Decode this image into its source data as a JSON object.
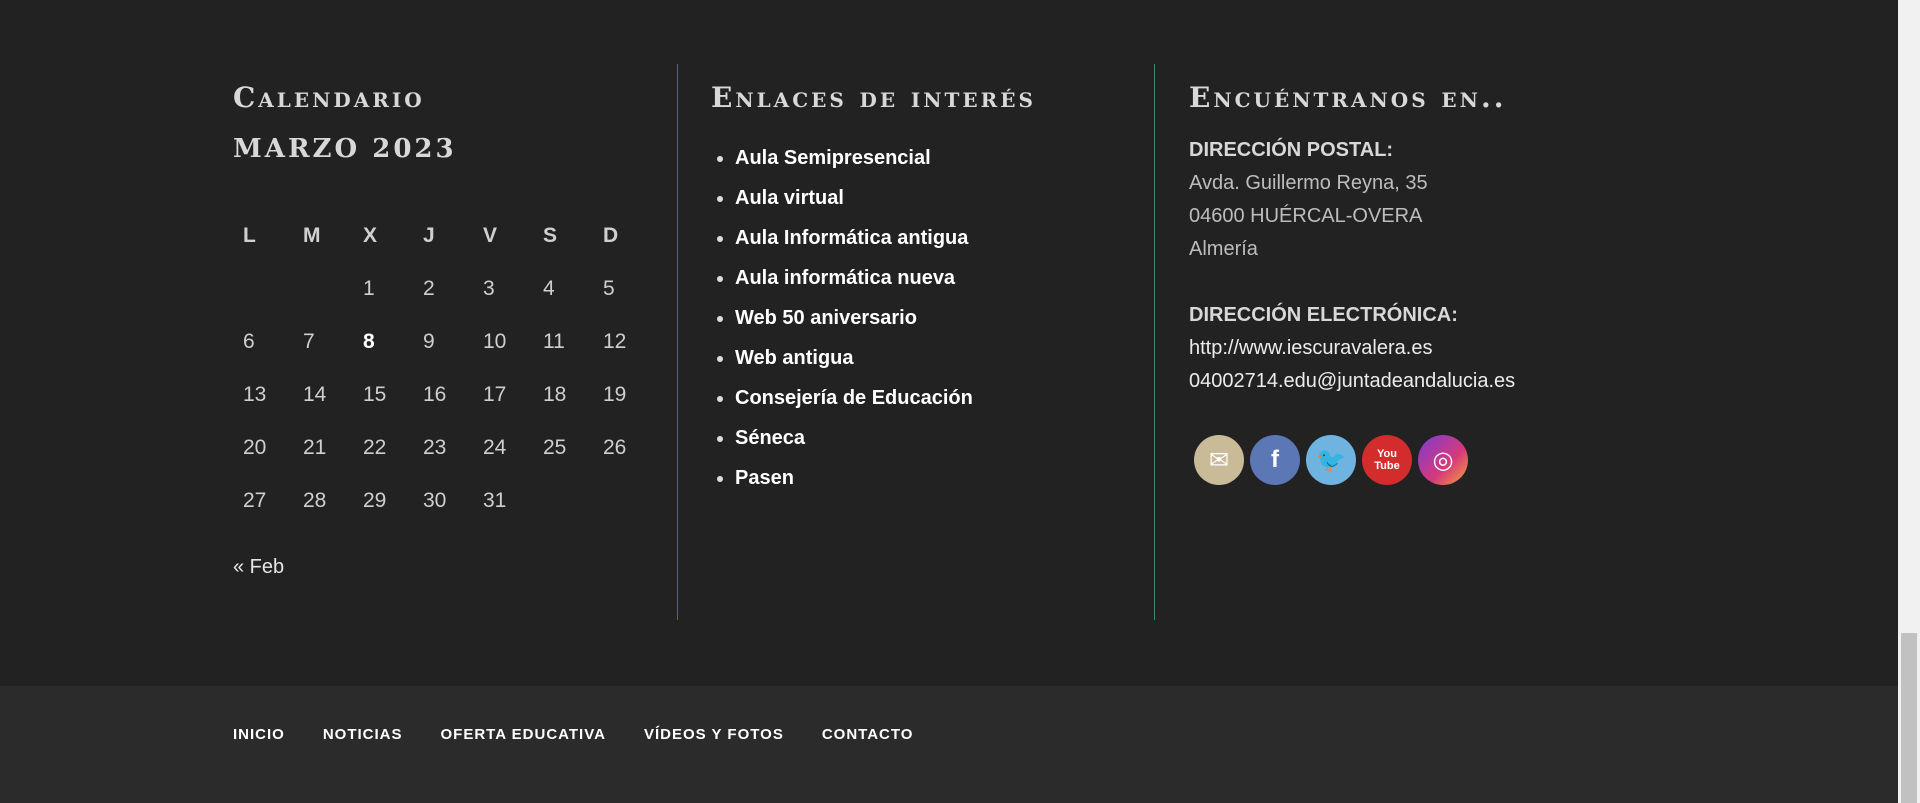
{
  "calendar": {
    "title": "Calendario",
    "caption": "MARZO 2023",
    "weekdays": [
      "L",
      "M",
      "X",
      "J",
      "V",
      "S",
      "D"
    ],
    "weeks": [
      [
        "",
        "",
        "1",
        "2",
        "3",
        "4",
        "5"
      ],
      [
        "6",
        "7",
        "8",
        "9",
        "10",
        "11",
        "12"
      ],
      [
        "13",
        "14",
        "15",
        "16",
        "17",
        "18",
        "19"
      ],
      [
        "20",
        "21",
        "22",
        "23",
        "24",
        "25",
        "26"
      ],
      [
        "27",
        "28",
        "29",
        "30",
        "31",
        "",
        ""
      ]
    ],
    "today": "8",
    "prev": "« Feb"
  },
  "links": {
    "title": "Enlaces de interés",
    "items": [
      "Aula Semipresencial",
      "Aula virtual",
      "Aula Informática antigua",
      "Aula informática nueva",
      "Web 50 aniversario",
      "Web antigua",
      "Consejería de Educación",
      "Séneca",
      "Pasen"
    ]
  },
  "contact": {
    "title": "Encuéntranos en..",
    "postal_label": "DIRECCIÓN POSTAL:",
    "address": [
      "Avda. Guillermo Reyna, 35",
      "04600 HUÉRCAL-OVERA",
      "Almería"
    ],
    "email_label": "DIRECCIÓN ELECTRÓNICA:",
    "website": "http://www.iescuravalera.es",
    "email": "04002714.edu@juntadeandalucia.es",
    "social_icons": [
      "email-icon",
      "facebook-icon",
      "twitter-icon",
      "youtube-icon",
      "instagram-icon"
    ],
    "social_glyphs": {
      "email": "✉",
      "facebook": "f",
      "twitter": "🐦",
      "youtube_1": "You",
      "youtube_2": "Tube",
      "instagram": "◎"
    }
  },
  "footer_nav": [
    "INICIO",
    "NOTICIAS",
    "OFERTA EDUCATIVA",
    "VÍDEOS Y FOTOS",
    "CONTACTO"
  ],
  "colors": {
    "background": "#222222",
    "footer_bar": "#2b2b2b",
    "divider_1": "#b14040",
    "divider_2": "#3a8a68"
  }
}
